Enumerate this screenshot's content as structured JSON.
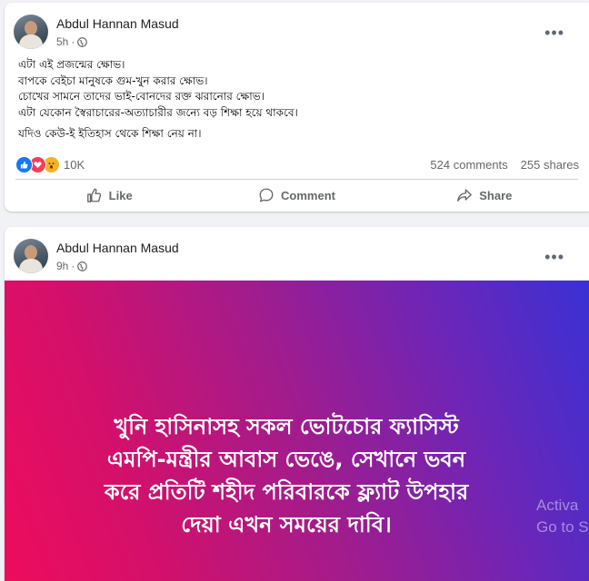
{
  "post1": {
    "author": "Abdul Hannan Masud",
    "time": "5h",
    "text_lines": [
      "এটা এই প্রজন্মের ক্ষোভ।",
      "বাপকে বেইচা মানুষকে গুম-খুন করার ক্ষোভ।",
      "চোখের সামনে তাদের ভাই-বোনদের রক্ত ঝরানোর ক্ষোভ।",
      "এটা যেকোন স্বৈরাচারের-অত্যাচারীর জন্যে বড় শিক্ষা হয়ে থাকবে।"
    ],
    "text_last": "যদিও কেউ-ই ইতিহাস থেকে শিক্ষা নেয় না।",
    "reaction_count": "10K",
    "comments": "524 comments",
    "shares": "255 shares",
    "actions": {
      "like": "Like",
      "comment": "Comment",
      "share": "Share"
    }
  },
  "post2": {
    "author": "Abdul Hannan Masud",
    "time": "9h",
    "banner_lines": [
      "খুনি হাসিনাসহ সকল ভোটচোর ফ্যাসিস্ট",
      "এমপি-মন্ত্রীর আবাস ভেঙে, সেখানে ভবন",
      "করে প্রতিটি শহীদ পরিবারকে ফ্ল্যাট উপহার",
      "দেয়া এখন সময়ের দাবি।"
    ],
    "banner_colors": [
      "#ee0c5c",
      "#a21c8c",
      "#3a31d4"
    ]
  },
  "watermark": {
    "line1": "Activa",
    "line2": "Go to S"
  },
  "icons": [
    "globe-icon",
    "more-icon",
    "like-icon",
    "love-icon",
    "wow-icon",
    "comment-icon",
    "share-icon"
  ],
  "accent": "#1877f2"
}
